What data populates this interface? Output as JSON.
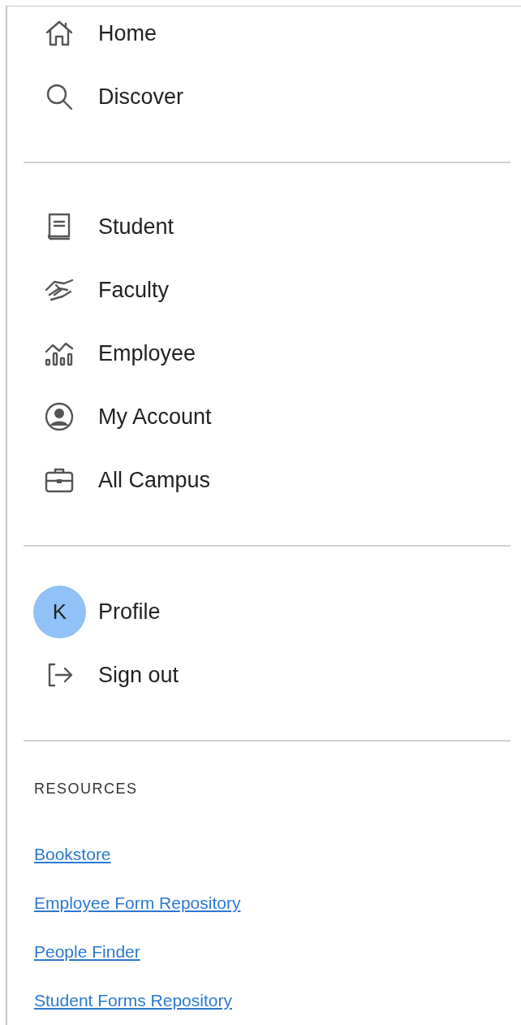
{
  "nav_groups": [
    {
      "items": [
        {
          "label": "Home"
        },
        {
          "label": "Discover"
        }
      ]
    },
    {
      "items": [
        {
          "label": "Student"
        },
        {
          "label": "Faculty"
        },
        {
          "label": "Employee"
        },
        {
          "label": "My Account"
        },
        {
          "label": "All Campus"
        }
      ]
    },
    {
      "items": [
        {
          "initial": "K",
          "label": "Profile"
        },
        {
          "label": "Sign out"
        }
      ]
    }
  ],
  "resources": {
    "heading": "RESOURCES",
    "links": [
      "Bookstore",
      "Employee Form Repository",
      "People Finder",
      "Student Forms Repository"
    ]
  }
}
